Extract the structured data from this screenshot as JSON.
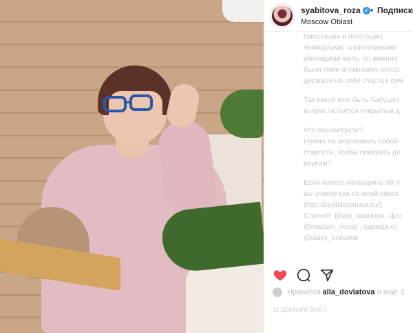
{
  "post": {
    "username": "syabitova_roza",
    "verified_mark": "✓",
    "separator": "•",
    "follow_label": "Подписки",
    "location": "Moscow Oblast"
  },
  "caption": {
    "lines": [
      "смешными и нелепыми,",
      "немодными, хлопотливыми,",
      "умеющими жить, но именно",
      "были теми атлантами, котор",
      "держали на себе счастье сем"
    ],
    "paragraph2": [
      "Так какой мне быть бабушко",
      "вопрос остаётся открытым д"
    ],
    "paragraph3": [
      "Что посоветуете?",
      "Нужно ли жертвовать собой",
      "старости, чтобы помогать де",
      "внукам?"
    ],
    "paragraph4": [
      "Если хотите поговорить об л",
      "вы знаете как со мной связа",
      "(http://syabitovaroza.ru/)",
      "Стилист @taty_talanova , фот",
      "@madam_visual , одежда от",
      "@daisy_knitwear"
    ]
  },
  "likes": {
    "prefix": "Нравится",
    "user": "alla_dovlatova",
    "suffix": "и ещё 3"
  },
  "date": "12 ДЕКАБРЯ 2020 Г.",
  "icons": {
    "like": "heart-icon",
    "comment": "comment-icon",
    "share": "share-icon"
  },
  "colors": {
    "like_heart": "#ed4956",
    "verified": "#3897f0",
    "text_dark": "#262626",
    "text_faded": "#c7c7c7"
  }
}
